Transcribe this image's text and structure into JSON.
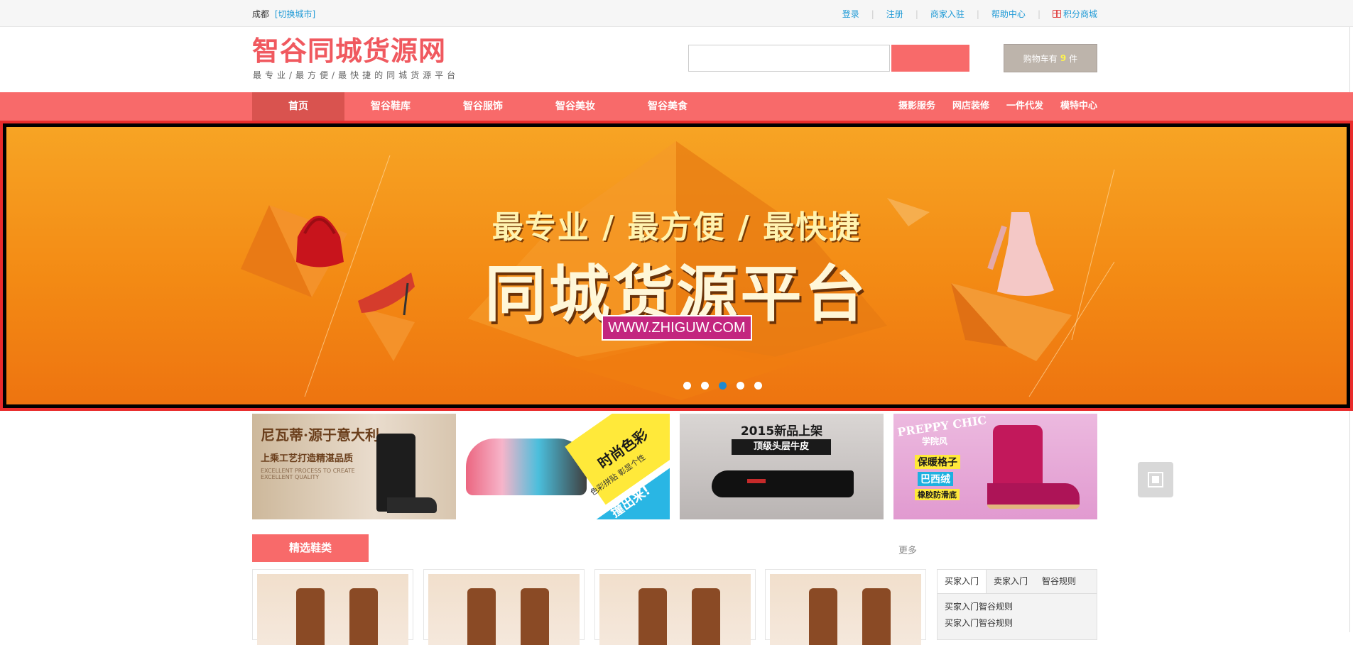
{
  "topbar": {
    "city": "成都",
    "switch_city": "[切换城市]",
    "links": [
      "登录",
      "注册",
      "商家入驻",
      "帮助中心",
      "积分商城"
    ]
  },
  "header": {
    "logo_title": "智谷同城货源网",
    "logo_subtitle": "最专业/最方便/最快捷的同城货源平台",
    "search_placeholder": "",
    "search_button": "",
    "cart_prefix": "购物车有",
    "cart_count": "9",
    "cart_suffix": "件"
  },
  "nav": {
    "items": [
      "首页",
      "智谷鞋库",
      "智谷服饰",
      "智谷美妆",
      "智谷美食"
    ],
    "active_index": 0,
    "right_links": [
      "摄影服务",
      "网店装修",
      "一件代发",
      "模特中心"
    ]
  },
  "banner": {
    "tagline": "最专业 / 最方便 / 最快捷",
    "headline": "同城货源平台",
    "url": "WWW.ZHIGUW.COM",
    "slide_count": 5,
    "active_slide": 2,
    "colors": {
      "accent": "#f86a6a",
      "banner": "#f38a14"
    }
  },
  "promos": [
    {
      "line1": "尼瓦蒂·源于意大利",
      "line2": "上乘工艺打造精湛品质",
      "line3": "EXCELLENT PROCESS TO CREATE EXCELLENT QUALITY"
    },
    {
      "line1": "时尚色彩",
      "line2": "色彩拼贴 彰显个性",
      "line3": "撞出来!"
    },
    {
      "line1": "2015新品上架",
      "line2": "顶级头层牛皮"
    },
    {
      "line1": "PREPPY CHIC",
      "line2": "学院风",
      "line3": "保暖格子",
      "line4": "巴西绒",
      "line5": "橡胶防滑底"
    }
  ],
  "section": {
    "title": "精选鞋类",
    "more": "更多"
  },
  "info": {
    "tabs": [
      "买家入门",
      "卖家入门",
      "智谷规则"
    ],
    "active_tab": 0,
    "items": [
      "买家入门智谷规则",
      "买家入门智谷规则"
    ]
  }
}
